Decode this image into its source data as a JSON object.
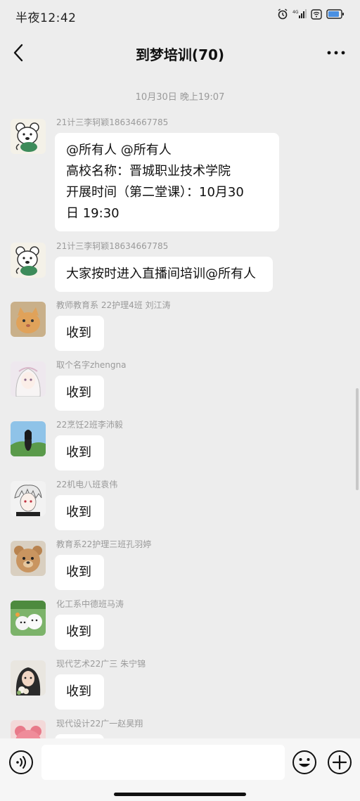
{
  "status_bar": {
    "time": "半夜12:42",
    "icons": [
      "alarm-icon",
      "signal-icon",
      "wifi-icon",
      "battery-icon"
    ]
  },
  "header": {
    "title": "到梦培训(70)",
    "back_icon": "back-chevron-icon",
    "more_icon": "more-icon"
  },
  "chat": {
    "timestamp": "10月30日 晚上19:07",
    "messages": [
      {
        "sender": "21计三李轲颖18634667785",
        "lines": [
          "@所有人 @所有人",
          "高校名称：晋城职业技术学院",
          "开展时间（第二堂课）：10月30",
          "日 19:30"
        ]
      },
      {
        "sender": "21计三李轲颖18634667785",
        "lines": [
          "大家按时进入直播间培训@所有人"
        ]
      },
      {
        "sender": "教师教育系 22护理4班 刘江涛",
        "lines": [
          "收到"
        ]
      },
      {
        "sender": "取个名字zhengna",
        "lines": [
          "收到"
        ]
      },
      {
        "sender": "22烹饪2班李沛毅",
        "lines": [
          "收到"
        ]
      },
      {
        "sender": "22机电八班袁伟",
        "lines": [
          "收到"
        ]
      },
      {
        "sender": "教育系22护理三班孔羽婷",
        "lines": [
          "收到"
        ]
      },
      {
        "sender": "化工系中德班马涛",
        "lines": [
          "收到"
        ]
      },
      {
        "sender": "现代艺术22广三 朱宁锦",
        "lines": [
          "收到"
        ]
      },
      {
        "sender": "现代设计22广一赵昊翔",
        "lines": []
      }
    ]
  },
  "input_bar": {
    "placeholder": "",
    "voice_icon": "voice-icon",
    "emoji_icon": "emoji-icon",
    "plus_icon": "plus-icon"
  },
  "colors": {
    "background": "#ededed",
    "bubble": "#ffffff",
    "meta_text": "#9a9a9a"
  }
}
